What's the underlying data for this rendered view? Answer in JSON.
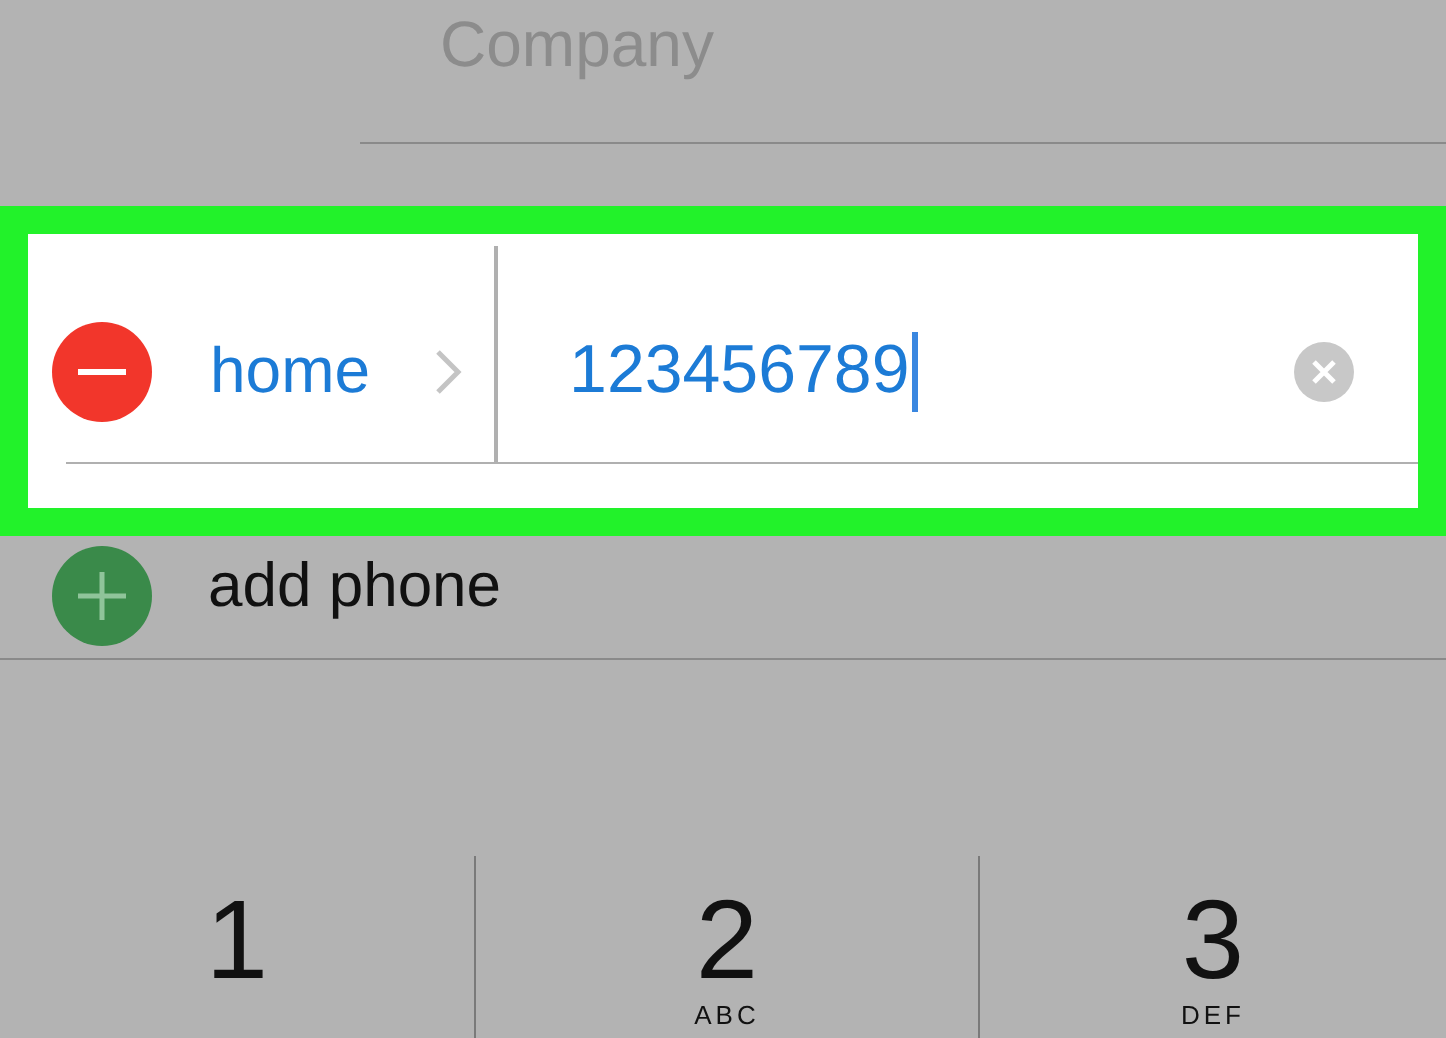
{
  "company": {
    "placeholder": "Company"
  },
  "phone_entry": {
    "label": "home",
    "value": "123456789",
    "highlighted": true
  },
  "add_phone": {
    "label": "add phone"
  },
  "keypad": [
    {
      "digit": "1"
    },
    {
      "digit": "2",
      "letters": "ABC"
    },
    {
      "digit": "3",
      "letters": "DEF"
    }
  ]
}
